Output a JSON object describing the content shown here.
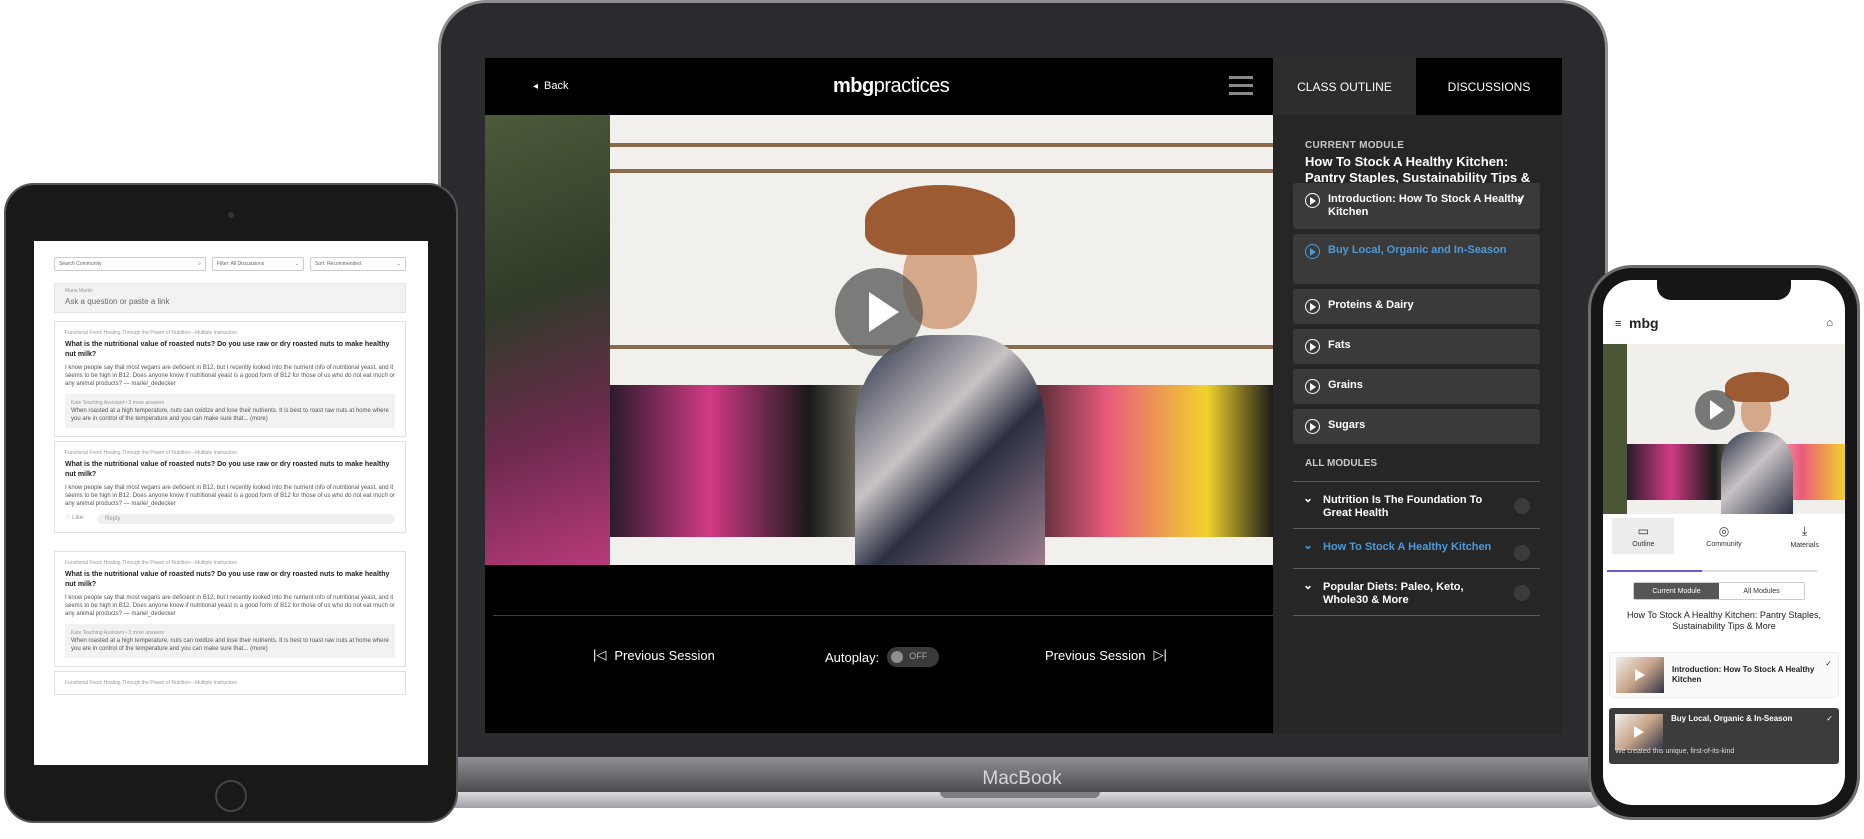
{
  "laptop": {
    "device_label": "MacBook",
    "header": {
      "back_label": "Back",
      "brand_strong": "mbg",
      "brand_light": "practices"
    },
    "controls": {
      "previous_label": "Previous Session",
      "autoplay_label": "Autoplay:",
      "autoplay_state": "OFF",
      "next_label": "Previous Session"
    },
    "sidebar": {
      "tabs": [
        {
          "label": "CLASS OUTLINE"
        },
        {
          "label": "DISCUSSIONS"
        }
      ],
      "current_module_label": "CURRENT MODULE",
      "current_module_title": "How To Stock A Healthy Kitchen: Pantry Staples, Sustainability Tips & More",
      "lessons": [
        {
          "label": "Introduction: How To Stock A Healthy Kitchen",
          "completed": true
        },
        {
          "label": "Buy Local, Organic and In-Season",
          "highlighted": true
        },
        {
          "label": "Proteins & Dairy"
        },
        {
          "label": "Fats"
        },
        {
          "label": "Grains"
        },
        {
          "label": "Sugars"
        }
      ],
      "all_modules_label": "ALL MODULES",
      "modules": [
        {
          "label": "Nutrition Is The Foundation To Great Health"
        },
        {
          "label": "How To Stock A Healthy Kitchen",
          "active": true
        },
        {
          "label": "Popular Diets: Paleo, Keto, Whole30 & More"
        }
      ]
    }
  },
  "tablet": {
    "filters": [
      {
        "label": "Search Community",
        "icon": "search-icon"
      },
      {
        "label": "Filter: All Discussions",
        "icon": "chevron-down-icon"
      },
      {
        "label": "Sort: Recommended",
        "icon": "chevron-down-icon"
      }
    ],
    "ask": {
      "user": "Maria Martin",
      "placeholder": "Ask a question or paste a link"
    },
    "posts": [
      {
        "category": "Functional Food: Healing Through the Power of Nutrition—Multiple Instructors",
        "question": "What is the nutritional value of roasted nuts? Do you use raw or dry roasted nuts to make healthy nut milk?",
        "body": "I know people say that most vegans are deficient in B12, but I recently looked into the nutrient info of nutritional yeast, and it seems to be high in B12. Does anyone know if nutritional yeast is a good form of B12 for those of us who do not eat much or any animal products? — mariel_dedecker",
        "reply_author": "Kate  Teaching Assistant • 3 more answers",
        "reply_body": "When roasted at a high temperature, nuts can oxidize and lose their nutrients. It is best to roast raw nuts at home where you are in control of the temperature and you can make sure that... (more)"
      },
      {
        "category": "Functional Food: Healing Through the Power of Nutrition—Multiple Instructors",
        "question": "What is the nutritional value of roasted nuts? Do you use raw or dry roasted nuts to make healthy nut milk?",
        "body": "I know people say that most vegans are deficient in B12, but I recently looked into the nutrient info of nutritional yeast, and it seems to be high in B12. Does anyone know if nutritional yeast is a good form of B12 for those of us who do not eat much or any animal products? — mariel_dedecker",
        "like_label": "Like",
        "reply_label": "Reply"
      },
      {
        "category": "Functional Food: Healing Through the Power of Nutrition—Multiple Instructors",
        "question": "What is the nutritional value of roasted nuts? Do you use raw or dry roasted nuts to make healthy nut milk?",
        "body": "I know people say that most vegans are deficient in B12, but I recently looked into the nutrient info of nutritional yeast, and it seems to be high in B12. Does anyone know if nutritional yeast is a good form of B12 for those of us who do not eat much or any animal products? — mariel_dedecker",
        "reply_author": "Kate  Teaching Assistant • 3 more answers",
        "reply_body": "When roasted at a high temperature, nuts can oxidize and lose their nutrients. It is best to roast raw nuts at home where you are in control of the temperature and you can make sure that... (more)"
      },
      {
        "category": "Functional Food: Healing Through the Power of Nutrition—Multiple Instructors"
      }
    ]
  },
  "phone": {
    "logo": "mbg",
    "tabs": [
      {
        "label": "Outline",
        "icon": "outline-icon"
      },
      {
        "label": "Community",
        "icon": "community-icon"
      },
      {
        "label": "Materials",
        "icon": "download-icon"
      }
    ],
    "progress": 0.45,
    "segments": [
      "Current Module",
      "All Modules"
    ],
    "module_title": "How To Stock A Healthy Kitchen: Pantry Staples, Sustainability Tips & More",
    "lessons": [
      {
        "label": "Introduction: How To Stock A Healthy Kitchen"
      },
      {
        "label": "Buy Local, Organic & In-Season"
      }
    ],
    "lesson_description": "We created this unique, first-of-its-kind"
  },
  "colors": {
    "accent_blue": "#4e9ad8",
    "panel_dark": "#262626",
    "lesson_bg": "#3a3a3a"
  }
}
